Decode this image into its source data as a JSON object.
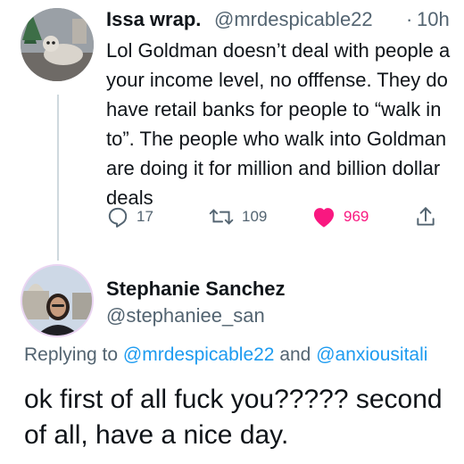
{
  "tweet": {
    "author_name": "Issa wrap.",
    "author_handle": "@mrdespicable22",
    "separator": "·",
    "time": "10h",
    "text": "Lol Goldman doesn’t deal with people a\nyour income level, no offfense. They do\nhave retail banks for people to “walk in\nto”. The people who walk into Goldman\nare doing it for million and billion dollar\ndeals",
    "actions": {
      "reply_count": "17",
      "retweet_count": "109",
      "like_count": "969"
    },
    "icons": {
      "reply": "reply-icon",
      "retweet": "retweet-icon",
      "like": "heart-icon",
      "share": "share-icon"
    },
    "like_color": "#f91880"
  },
  "reply": {
    "author_name": "Stephanie Sanchez",
    "author_handle": "@stephaniee_san",
    "replying_prefix": "Replying to",
    "replying_user1": "@mrdespicable22",
    "replying_and": "and",
    "replying_user2": "@anxiousitali",
    "text": "ok first of all fuck you????? second\nof all, have a nice day."
  },
  "colors": {
    "text": "#0f1419",
    "secondary": "#536471",
    "link": "#1d9bf0",
    "thread_line": "#cfd9de"
  }
}
